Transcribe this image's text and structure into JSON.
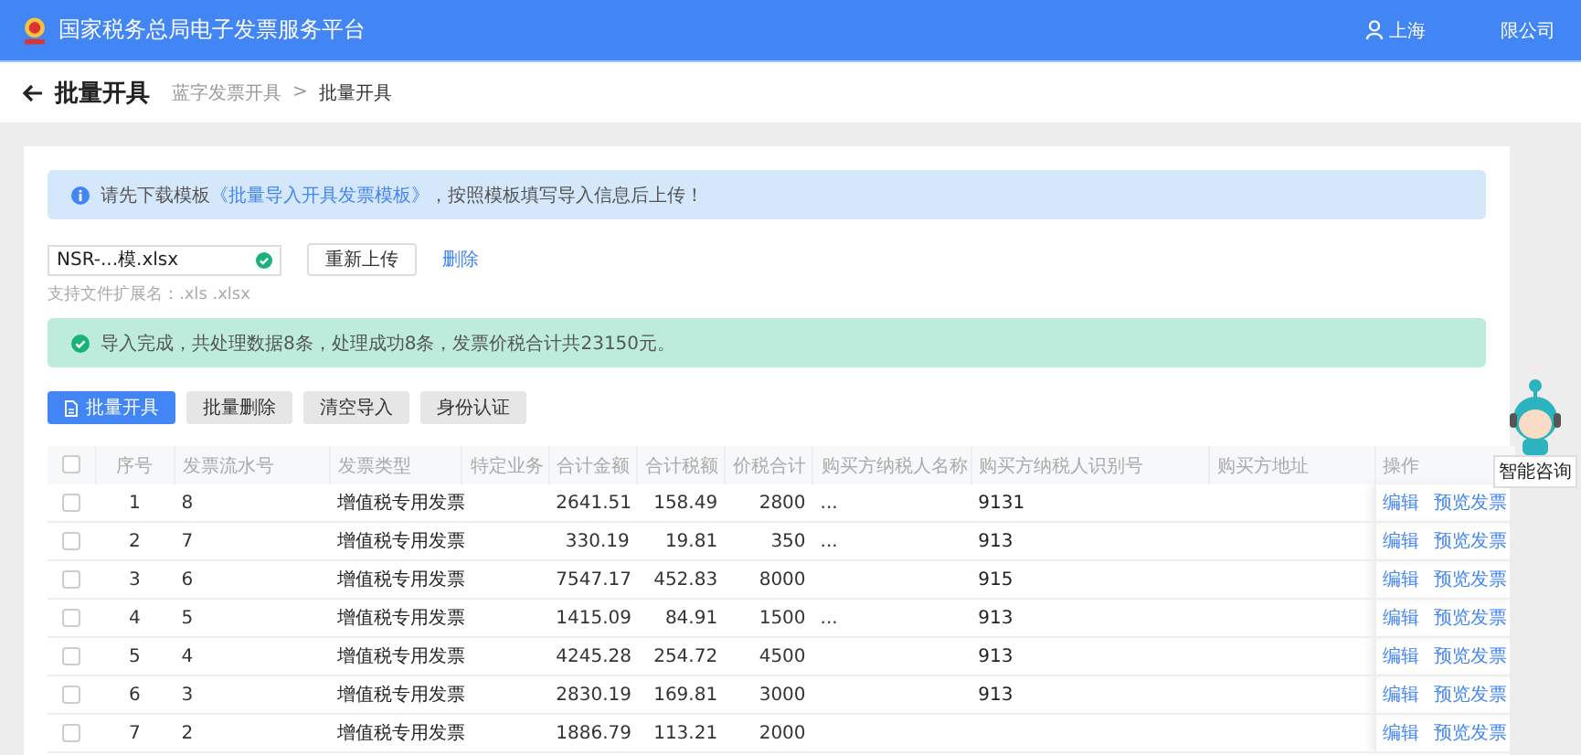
{
  "header": {
    "title": "国家税务总局电子发票服务平台",
    "user_parts": [
      "上海",
      "限公司"
    ]
  },
  "page": {
    "title": "批量开具",
    "breadcrumb": [
      "蓝字发票开具",
      "批量开具"
    ],
    "breadcrumb_sep": ">"
  },
  "notice": {
    "before": "请先下载模板",
    "link": "《批量导入开具发票模板》",
    "after": "，按照模板填写导入信息后上传！"
  },
  "upload": {
    "file": "NSR-...模.xlsx",
    "uploaded": true,
    "reupload": "重新上传",
    "delete": "删除",
    "hint": "支持文件扩展名：.xls .xlsx"
  },
  "result": {
    "text": "导入完成，共处理数据8条，处理成功8条，发票价税合计共23150元。"
  },
  "actions": [
    {
      "label": "批量开具",
      "kind": "primary"
    },
    {
      "label": "批量删除",
      "kind": "plain"
    },
    {
      "label": "清空导入",
      "kind": "plain"
    },
    {
      "label": "身份认证",
      "kind": "plain"
    }
  ],
  "table": {
    "all_checked": false,
    "columns": [
      "序号",
      "发票流水号",
      "发票类型",
      "特定业务",
      "合计金额",
      "合计税额",
      "价税合计",
      "购买方纳税人名称",
      "购买方纳税人识别号",
      "购买方地址",
      "操作"
    ],
    "rows": [
      {
        "checked": false,
        "cells": [
          "1",
          "8",
          "增值税专用发票",
          "",
          "2641.51",
          "158.49",
          "2800",
          "...",
          "9131",
          ""
        ],
        "actions": [
          "编辑",
          "预览发票"
        ]
      },
      {
        "checked": false,
        "cells": [
          "2",
          "7",
          "增值税专用发票",
          "",
          "330.19",
          "19.81",
          "350",
          "...",
          "913",
          ""
        ],
        "actions": [
          "编辑",
          "预览发票"
        ]
      },
      {
        "checked": false,
        "cells": [
          "3",
          "6",
          "增值税专用发票",
          "",
          "7547.17",
          "452.83",
          "8000",
          "",
          "915",
          ""
        ],
        "actions": [
          "编辑",
          "预览发票"
        ]
      },
      {
        "checked": false,
        "cells": [
          "4",
          "5",
          "增值税专用发票",
          "",
          "1415.09",
          "84.91",
          "1500",
          "...",
          "913",
          ""
        ],
        "actions": [
          "编辑",
          "预览发票"
        ]
      },
      {
        "checked": false,
        "cells": [
          "5",
          "4",
          "增值税专用发票",
          "",
          "4245.28",
          "254.72",
          "4500",
          "",
          "913",
          ""
        ],
        "actions": [
          "编辑",
          "预览发票"
        ]
      },
      {
        "checked": false,
        "cells": [
          "6",
          "3",
          "增值税专用发票",
          "",
          "2830.19",
          "169.81",
          "3000",
          "",
          "913",
          ""
        ],
        "actions": [
          "编辑",
          "预览发票"
        ]
      },
      {
        "checked": false,
        "cells": [
          "7",
          "2",
          "增值税专用发票",
          "",
          "1886.79",
          "113.21",
          "2000",
          "",
          "",
          ""
        ],
        "actions": [
          "编辑",
          "预览发票"
        ]
      }
    ]
  },
  "assistant": {
    "label": "智能咨询"
  }
}
